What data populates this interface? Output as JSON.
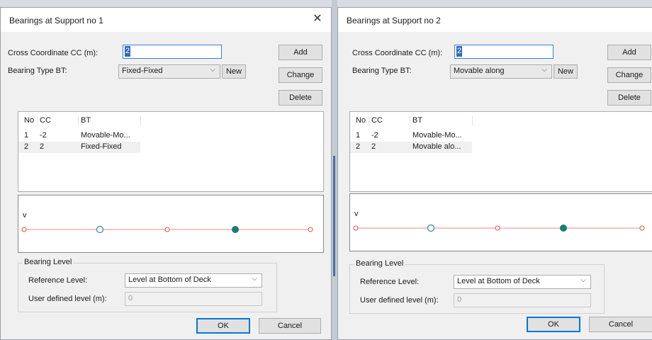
{
  "dialogs": [
    {
      "title": "Bearings at Support no 1",
      "close": "✕",
      "cc_label": "Cross Coordinate CC (m):",
      "cc_value": "2",
      "bt_label": "Bearing Type BT:",
      "bt_value": "Fixed-Fixed",
      "new_label": "New",
      "add_label": "Add",
      "change_label": "Change",
      "delete_label": "Delete",
      "columns": [
        "No",
        "CC",
        "BT"
      ],
      "rows": [
        {
          "no": "1",
          "cc": "-2",
          "bt": "Movable-Mo..."
        },
        {
          "no": "2",
          "cc": "2",
          "bt": "Fixed-Fixed"
        }
      ],
      "plot_axis_label": "v",
      "level_group_title": "Bearing Level",
      "ref_label": "Reference Level:",
      "ref_value": "Level at Bottom of Deck",
      "user_label": "User defined level (m):",
      "user_value": "0",
      "ok_label": "OK",
      "cancel_label": "Cancel"
    },
    {
      "title": "Bearings at Support no 2",
      "close": "✕",
      "cc_label": "Cross Coordinate CC (m):",
      "cc_value": "2",
      "bt_label": "Bearing Type BT:",
      "bt_value": "Movable along",
      "new_label": "New",
      "add_label": "Add",
      "change_label": "Change",
      "delete_label": "Delete",
      "columns": [
        "No",
        "CC",
        "BT"
      ],
      "rows": [
        {
          "no": "1",
          "cc": "-2",
          "bt": "Movable-Mo..."
        },
        {
          "no": "2",
          "cc": "2",
          "bt": "Movable alo..."
        }
      ],
      "plot_axis_label": "v",
      "level_group_title": "Bearing Level",
      "ref_label": "Reference Level:",
      "ref_value": "Level at Bottom of Deck",
      "user_label": "User defined level (m):",
      "user_value": "0",
      "ok_label": "OK",
      "cancel_label": "Cancel"
    }
  ],
  "colors": {
    "plot_line": "#e8898a",
    "open_marker": "#2e8b86",
    "filled_marker": "#1a7d78",
    "end_marker": "#d9534f",
    "selection": "#316ac5",
    "focus_border": "#0078d7"
  },
  "icons": {
    "close": "close-icon",
    "dropdown": "chevron-down-icon"
  }
}
